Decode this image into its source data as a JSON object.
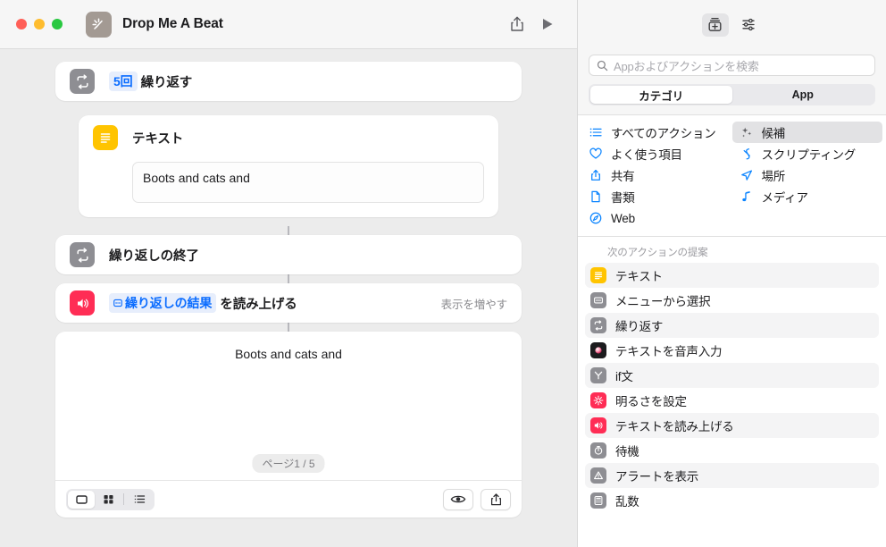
{
  "window": {
    "title": "Drop Me A Beat",
    "app_icon": "sparkle-wand-icon",
    "traffic_lights": [
      "close",
      "minimize",
      "maximize"
    ],
    "toolbar": {
      "share_label": "share-icon",
      "play_label": "play-icon"
    }
  },
  "canvas": {
    "actions": [
      {
        "id": "repeat-start",
        "icon": "repeat-icon",
        "icon_color": "#8e8e93",
        "token": "5回",
        "label": "繰り返す"
      },
      {
        "id": "text",
        "icon": "text-icon",
        "icon_color": "#ffc400",
        "label": "テキスト",
        "field_value": "Boots and cats and"
      },
      {
        "id": "repeat-end",
        "icon": "repeat-icon",
        "icon_color": "#8e8e93",
        "label": "繰り返しの終了"
      },
      {
        "id": "speak-text",
        "icon": "speaker-icon",
        "icon_color": "#ff2d55",
        "token": "繰り返しの結果",
        "label": "を読み上げる",
        "more_label": "表示を増やす"
      }
    ],
    "preview": {
      "text": "Boots and cats and",
      "page_label": "ページ1 / 5",
      "view_modes": [
        {
          "name": "single-view",
          "icon": "rectangle-icon",
          "selected": true
        },
        {
          "name": "grid-view",
          "icon": "grid-icon",
          "selected": false
        },
        {
          "name": "list-view",
          "icon": "list-icon",
          "selected": false
        }
      ],
      "right_buttons": [
        {
          "name": "quicklook-button",
          "icon": "eye-icon"
        },
        {
          "name": "share-button",
          "icon": "share-icon"
        }
      ]
    }
  },
  "sidebar": {
    "toolbar": [
      {
        "name": "action-library-button",
        "icon": "library-add-icon",
        "active": true
      },
      {
        "name": "shortcut-details-button",
        "icon": "sliders-icon",
        "active": false
      }
    ],
    "search": {
      "placeholder": "Appおよびアクションを検索",
      "value": "",
      "icon": "search-icon"
    },
    "segmented": {
      "options": [
        "カテゴリ",
        "App"
      ],
      "selected": "カテゴリ"
    },
    "categories": [
      {
        "label": "すべてのアクション",
        "icon": "list-bullets-icon",
        "selected": false,
        "col": 0
      },
      {
        "label": "よく使う項目",
        "icon": "heart-icon",
        "selected": false,
        "col": 0
      },
      {
        "label": "共有",
        "icon": "share-icon",
        "selected": false,
        "col": 0
      },
      {
        "label": "書類",
        "icon": "document-icon",
        "selected": false,
        "col": 0
      },
      {
        "label": "Web",
        "icon": "safari-compass-icon",
        "selected": false,
        "col": 0
      },
      {
        "label": "候補",
        "icon": "sparkles-icon",
        "selected": true,
        "col": 1
      },
      {
        "label": "スクリプティング",
        "icon": "scripting-icon",
        "selected": false,
        "col": 1
      },
      {
        "label": "場所",
        "icon": "location-arrow-icon",
        "selected": false,
        "col": 1
      },
      {
        "label": "メディア",
        "icon": "music-note-icon",
        "selected": false,
        "col": 1
      }
    ],
    "suggestions": {
      "header": "次のアクションの提案",
      "items": [
        {
          "label": "テキスト",
          "icon": "text-icon",
          "color": "#ffc400"
        },
        {
          "label": "メニューから選択",
          "icon": "menu-select-icon",
          "color": "#8e8e93"
        },
        {
          "label": "繰り返す",
          "icon": "repeat-icon",
          "color": "#8e8e93"
        },
        {
          "label": "テキストを音声入力",
          "icon": "dictate-icon",
          "color": "#1c1c1e"
        },
        {
          "label": "if文",
          "icon": "branch-icon",
          "color": "#8e8e93"
        },
        {
          "label": "明るさを設定",
          "icon": "brightness-icon",
          "color": "#ff2d55"
        },
        {
          "label": "テキストを読み上げる",
          "icon": "speaker-icon",
          "color": "#ff2d55"
        },
        {
          "label": "待機",
          "icon": "timer-icon",
          "color": "#8e8e93"
        },
        {
          "label": "アラートを表示",
          "icon": "alert-icon",
          "color": "#8e8e93"
        },
        {
          "label": "乱数",
          "icon": "calculator-icon",
          "color": "#8e8e93"
        }
      ]
    }
  },
  "colors": {
    "accent_blue": "#0a6cff",
    "yellow": "#ffc400",
    "red": "#ff2d55",
    "gray": "#8e8e93",
    "canvas_bg": "#ececec",
    "sidebar_bg": "#f6f6f6"
  }
}
